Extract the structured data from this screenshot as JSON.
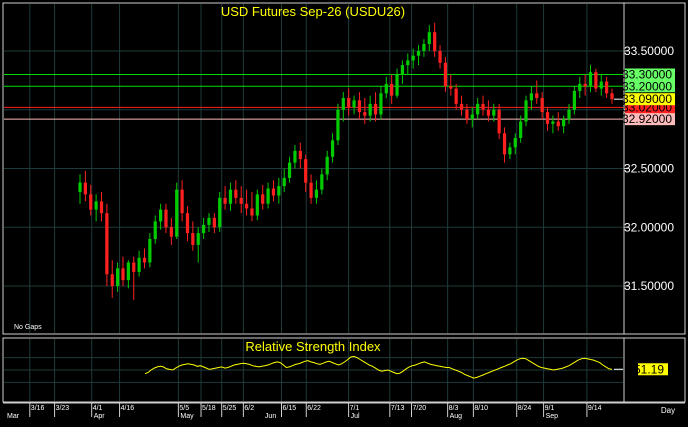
{
  "chart_data": [
    {
      "type": "candlestick",
      "title": "USD Futures Sep-26 (USDU26)",
      "ylim": [
        31.1,
        33.9
      ],
      "y_ticks": [
        "33.50000",
        "33.00000",
        "32.50000",
        "32.00000",
        "31.50000"
      ],
      "y_tick_values": [
        33.5,
        33.0,
        32.5,
        32.0,
        31.5
      ],
      "bottom_left_note": "No Gaps",
      "up_color": "#00cc00",
      "down_color": "#ff2020",
      "horizontal_lines": [
        {
          "value": 33.3,
          "label": "33.30000",
          "line_color": "#00dd00",
          "box_color": "#66ff66",
          "text_color": "#000000"
        },
        {
          "value": 33.2,
          "label": "33.20000",
          "line_color": "#00dd00",
          "box_color": "#66ff66",
          "text_color": "#000000"
        },
        {
          "value": 33.02,
          "label": "33.02000",
          "line_color": "#ff2020",
          "box_color": "#ff2020",
          "text_color": "#000000"
        },
        {
          "value": 32.92,
          "label": "32.92000",
          "line_color": "#ffbbbb",
          "box_color": "#ffbbbb",
          "text_color": "#000000"
        }
      ],
      "last_price": {
        "value": 33.09,
        "label": "33.09000",
        "box_color": "#ffff00",
        "text_color": "#000000"
      },
      "candles": [
        [
          32.3,
          32.45,
          32.2,
          32.38
        ],
        [
          32.38,
          32.48,
          32.22,
          32.28
        ],
        [
          32.28,
          32.36,
          32.1,
          32.15
        ],
        [
          32.15,
          32.28,
          32.05,
          32.22
        ],
        [
          32.22,
          32.3,
          32.05,
          32.12
        ],
        [
          32.12,
          32.2,
          31.5,
          31.6
        ],
        [
          31.6,
          31.72,
          31.4,
          31.5
        ],
        [
          31.5,
          31.7,
          31.45,
          31.65
        ],
        [
          31.65,
          31.75,
          31.5,
          31.55
        ],
        [
          31.55,
          31.72,
          31.48,
          31.7
        ],
        [
          31.7,
          31.75,
          31.38,
          31.62
        ],
        [
          31.62,
          31.8,
          31.58,
          31.74
        ],
        [
          31.74,
          31.82,
          31.65,
          31.7
        ],
        [
          31.7,
          31.95,
          31.66,
          31.9
        ],
        [
          31.9,
          32.1,
          31.86,
          32.05
        ],
        [
          32.05,
          32.2,
          31.98,
          32.15
        ],
        [
          32.15,
          32.2,
          31.95,
          32.0
        ],
        [
          32.0,
          32.08,
          31.85,
          31.92
        ],
        [
          31.92,
          32.38,
          31.9,
          32.32
        ],
        [
          32.32,
          32.4,
          32.05,
          32.12
        ],
        [
          32.12,
          32.18,
          31.88,
          31.95
        ],
        [
          31.95,
          32.05,
          31.8,
          31.85
        ],
        [
          31.85,
          32.0,
          31.7,
          31.95
        ],
        [
          31.95,
          32.08,
          31.9,
          32.02
        ],
        [
          32.02,
          32.12,
          31.96,
          32.08
        ],
        [
          32.08,
          32.12,
          31.95,
          32.0
        ],
        [
          32.0,
          32.3,
          31.96,
          32.25
        ],
        [
          32.25,
          32.35,
          32.15,
          32.2
        ],
        [
          32.2,
          32.38,
          32.14,
          32.32
        ],
        [
          32.32,
          32.4,
          32.2,
          32.25
        ],
        [
          32.25,
          32.35,
          32.12,
          32.2
        ],
        [
          32.2,
          32.32,
          32.1,
          32.16
        ],
        [
          32.16,
          32.3,
          32.05,
          32.1
        ],
        [
          32.1,
          32.32,
          32.06,
          32.28
        ],
        [
          32.28,
          32.36,
          32.15,
          32.2
        ],
        [
          32.2,
          32.38,
          32.16,
          32.33
        ],
        [
          32.33,
          32.4,
          32.22,
          32.27
        ],
        [
          32.27,
          32.42,
          32.2,
          32.35
        ],
        [
          32.35,
          32.5,
          32.3,
          32.42
        ],
        [
          32.42,
          32.6,
          32.38,
          32.55
        ],
        [
          32.55,
          32.7,
          32.5,
          32.65
        ],
        [
          32.65,
          32.72,
          32.5,
          32.58
        ],
        [
          32.58,
          32.62,
          32.3,
          32.38
        ],
        [
          32.38,
          32.45,
          32.2,
          32.25
        ],
        [
          32.25,
          32.4,
          32.2,
          32.32
        ],
        [
          32.32,
          32.5,
          32.28,
          32.45
        ],
        [
          32.45,
          32.65,
          32.4,
          32.6
        ],
        [
          32.6,
          32.8,
          32.55,
          32.74
        ],
        [
          32.74,
          33.05,
          32.7,
          33.0
        ],
        [
          33.0,
          33.15,
          32.9,
          33.1
        ],
        [
          33.1,
          33.18,
          32.95,
          33.02
        ],
        [
          33.02,
          33.12,
          32.96,
          33.08
        ],
        [
          33.08,
          33.15,
          32.92,
          32.98
        ],
        [
          32.98,
          33.1,
          32.88,
          32.95
        ],
        [
          32.95,
          33.12,
          32.9,
          33.05
        ],
        [
          33.05,
          33.15,
          32.9,
          32.96
        ],
        [
          32.96,
          33.2,
          32.92,
          33.14
        ],
        [
          33.14,
          33.28,
          33.1,
          33.22
        ],
        [
          33.22,
          33.3,
          33.05,
          33.12
        ],
        [
          33.12,
          33.35,
          33.1,
          33.3
        ],
        [
          33.3,
          33.42,
          33.22,
          33.38
        ],
        [
          33.38,
          33.48,
          33.3,
          33.42
        ],
        [
          33.42,
          33.52,
          33.35,
          33.46
        ],
        [
          33.46,
          33.55,
          33.38,
          33.5
        ],
        [
          33.5,
          33.6,
          33.45,
          33.56
        ],
        [
          33.56,
          33.72,
          33.5,
          33.66
        ],
        [
          33.66,
          33.74,
          33.45,
          33.5
        ],
        [
          33.5,
          33.55,
          33.35,
          33.4
        ],
        [
          33.4,
          33.45,
          33.15,
          33.2
        ],
        [
          33.2,
          33.3,
          33.12,
          33.18
        ],
        [
          33.18,
          33.22,
          33.0,
          33.05
        ],
        [
          33.05,
          33.12,
          32.95,
          33.0
        ],
        [
          33.0,
          33.05,
          32.88,
          32.92
        ],
        [
          32.92,
          33.02,
          32.85,
          32.96
        ],
        [
          32.96,
          33.1,
          32.92,
          33.05
        ],
        [
          33.05,
          33.12,
          32.95,
          33.0
        ],
        [
          33.0,
          33.08,
          32.9,
          32.95
        ],
        [
          32.95,
          33.05,
          32.9,
          33.0
        ],
        [
          33.0,
          33.05,
          32.75,
          32.8
        ],
        [
          32.8,
          32.85,
          32.55,
          32.62
        ],
        [
          32.62,
          32.72,
          32.58,
          32.68
        ],
        [
          32.68,
          32.8,
          32.62,
          32.76
        ],
        [
          32.76,
          32.95,
          32.72,
          32.9
        ],
        [
          32.9,
          33.12,
          32.86,
          33.08
        ],
        [
          33.08,
          33.2,
          33.0,
          33.14
        ],
        [
          33.14,
          33.25,
          33.05,
          33.1
        ],
        [
          33.1,
          33.15,
          32.92,
          32.98
        ],
        [
          32.98,
          33.02,
          32.82,
          32.88
        ],
        [
          32.88,
          32.95,
          32.8,
          32.9
        ],
        [
          32.9,
          32.98,
          32.82,
          32.86
        ],
        [
          32.86,
          32.95,
          32.8,
          32.92
        ],
        [
          32.92,
          33.05,
          32.88,
          33.0
        ],
        [
          33.0,
          33.2,
          32.96,
          33.16
        ],
        [
          33.16,
          33.28,
          33.1,
          33.22
        ],
        [
          33.22,
          33.3,
          33.12,
          33.2
        ],
        [
          33.2,
          33.38,
          33.15,
          33.32
        ],
        [
          33.32,
          33.35,
          33.15,
          33.18
        ],
        [
          33.18,
          33.3,
          33.12,
          33.24
        ],
        [
          33.24,
          33.28,
          33.1,
          33.14
        ],
        [
          33.14,
          33.18,
          33.05,
          33.09
        ]
      ]
    },
    {
      "type": "line",
      "title": "Relative Strength Index",
      "ylim": [
        0,
        100
      ],
      "line_color": "#ffff00",
      "last_value": {
        "value": 51.19,
        "label": "51.19",
        "box_color": "#ffff00"
      },
      "values": [
        44,
        46,
        50,
        53,
        55,
        56,
        55,
        52,
        51,
        50,
        53,
        56,
        58,
        59,
        60,
        59,
        58,
        56,
        57,
        55,
        53,
        51,
        52,
        53,
        54,
        55,
        53,
        54,
        56,
        58,
        59,
        60,
        61,
        60,
        59,
        57,
        56,
        55,
        56,
        57,
        58,
        60,
        62,
        63,
        62,
        58,
        54,
        55,
        57,
        59,
        60,
        62,
        64,
        65,
        63,
        62,
        60,
        59,
        61,
        63,
        64,
        62,
        60,
        58,
        60,
        63,
        67,
        71,
        72,
        70,
        67,
        64,
        61,
        58,
        56,
        53,
        50,
        48,
        49,
        50,
        48,
        46,
        44,
        45,
        48,
        52,
        55,
        57,
        58,
        60,
        62,
        63,
        61,
        59,
        58,
        57,
        56,
        55,
        54,
        54,
        52,
        50,
        48,
        46,
        43,
        41,
        39,
        37,
        38,
        40,
        42,
        44,
        46,
        48,
        50,
        52,
        54,
        56,
        58,
        60,
        63,
        66,
        68,
        69,
        68,
        65,
        62,
        59,
        56,
        54,
        53,
        52,
        51,
        50,
        51,
        52,
        53,
        55,
        57,
        60,
        63,
        66,
        68,
        69,
        68,
        67,
        66,
        64,
        62,
        58,
        55,
        52,
        51
      ]
    }
  ],
  "x_axis": {
    "ticks": [
      "3/16",
      "3/23",
      "4/1",
      "4/16",
      "5/5",
      "5/18",
      "5/25",
      "6/2",
      "6/15",
      "6/22",
      "7/1",
      "7/13",
      "7/20",
      "8/3",
      "8/10",
      "8/24",
      "9/1",
      "9/14"
    ],
    "tick_positions": [
      0.0417,
      0.0817,
      0.1417,
      0.1867,
      0.2817,
      0.3183,
      0.3517,
      0.3867,
      0.4483,
      0.4883,
      0.5567,
      0.6233,
      0.6583,
      0.7167,
      0.7583,
      0.8283,
      0.8717,
      0.9417
    ],
    "months": [
      "Mar",
      "Apr",
      "May",
      "Jun",
      "Jul",
      "Aug",
      "Sep"
    ],
    "month_positions": [
      0.0017,
      0.1417,
      0.2817,
      0.4183,
      0.5567,
      0.7167,
      0.8717
    ],
    "unit": "Day"
  }
}
